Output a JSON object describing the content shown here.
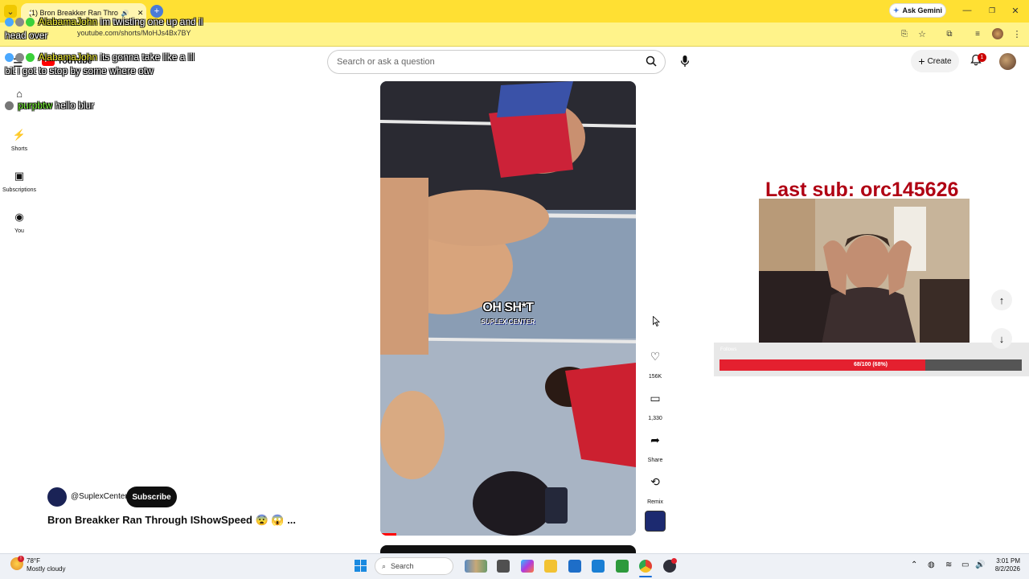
{
  "browser": {
    "tab_title": "(1) Bron Breakker Ran Thro",
    "url": "youtube.com/shorts/MoHJs4Bx7BY",
    "gemini_label": "Ask Gemini"
  },
  "youtube": {
    "logo_text": "YouTube",
    "search_placeholder": "Search or ask a question",
    "create_label": "Create",
    "notification_count": "1",
    "sidebar": [
      {
        "label": ""
      },
      {
        "label": "Shorts"
      },
      {
        "label": "Subscriptions"
      },
      {
        "label": "You"
      }
    ]
  },
  "chat": [
    {
      "user": "AlabamaJohn",
      "message": "im twisting one up and il head over"
    },
    {
      "user": "AlabamaJohn",
      "message": "its gonna take like a lil bit i got to stop by some where otw"
    },
    {
      "user": "purpbtw",
      "message": "hello blur"
    }
  ],
  "video": {
    "caption_main": "OH SH*T",
    "caption_sub": "SUPLEX CENTER",
    "likes": "156K",
    "comments": "1,330",
    "share_label": "Share",
    "remix_label": "Remix",
    "channel": "@SuplexCenter",
    "subscribe_label": "Subscribe",
    "title": "Bron Breakker Ran Through IShowSpeed 😨 😱 ..."
  },
  "stream_overlay": {
    "last_sub": "Last sub: orc145626",
    "follows_label": "Follows",
    "follow_progress_text": "68/100 (68%)",
    "follow_progress": 0.68
  },
  "taskbar": {
    "temperature": "78°F",
    "weather": "Mostly cloudy",
    "search_label": "Search",
    "time": "3:01 PM",
    "date": "8/2/2026"
  },
  "colors": {
    "tabbar": "#ffe033",
    "progress": "#e4202f",
    "last_sub": "#b00013"
  }
}
